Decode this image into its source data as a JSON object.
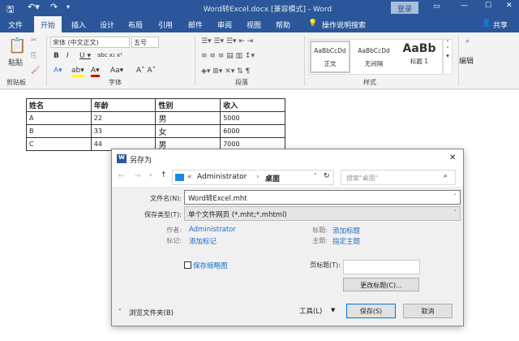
{
  "titlebar": {
    "title": "Word转Excel.docx [兼容模式] - Word",
    "login": "登录"
  },
  "tabs": [
    "文件",
    "开始",
    "插入",
    "设计",
    "布局",
    "引用",
    "邮件",
    "审阅",
    "视图",
    "帮助"
  ],
  "tell_me": "操作说明搜索",
  "share": "共享",
  "ribbon": {
    "paste": "粘贴",
    "clipboard": "剪贴板",
    "font_name": "宋体 (中文正文)",
    "font_size": "五号",
    "font_group": "字体",
    "para_group": "段落",
    "styles": [
      {
        "preview": "AaBbCcDd",
        "name": "正文"
      },
      {
        "preview": "AaBbCcDd",
        "name": "无间隔"
      },
      {
        "preview": "AaBb",
        "name": "标题 1"
      }
    ],
    "styles_group": "样式",
    "edit": "编辑"
  },
  "table": {
    "headers": [
      "姓名",
      "年龄",
      "性别",
      "收入"
    ],
    "rows": [
      [
        "A",
        "22",
        "男",
        "5000"
      ],
      [
        "B",
        "33",
        "女",
        "6000"
      ],
      [
        "C",
        "44",
        "男",
        "7000"
      ]
    ]
  },
  "dialog": {
    "title": "另存为",
    "path": [
      "Administrator",
      "桌面"
    ],
    "search_placeholder": "搜索\"桌面\"",
    "filename_label": "文件名(N):",
    "filename": "Word转Excel.mht",
    "type_label": "保存类型(T):",
    "type": "单个文件网页 (*.mht;*.mhtml)",
    "author_label": "作者:",
    "author": "Administrator",
    "tags_label": "标记:",
    "tags": "添加标记",
    "title_label": "标题:",
    "title_val": "添加标题",
    "subject_label": "主题:",
    "subject": "指定主题",
    "thumb": "保存缩略图",
    "page_title_label": "页标题(T):",
    "change_title": "更改标题(C)...",
    "browse": "浏览文件夹(B)",
    "tools": "工具(L)",
    "save": "保存(S)",
    "cancel": "取消"
  }
}
